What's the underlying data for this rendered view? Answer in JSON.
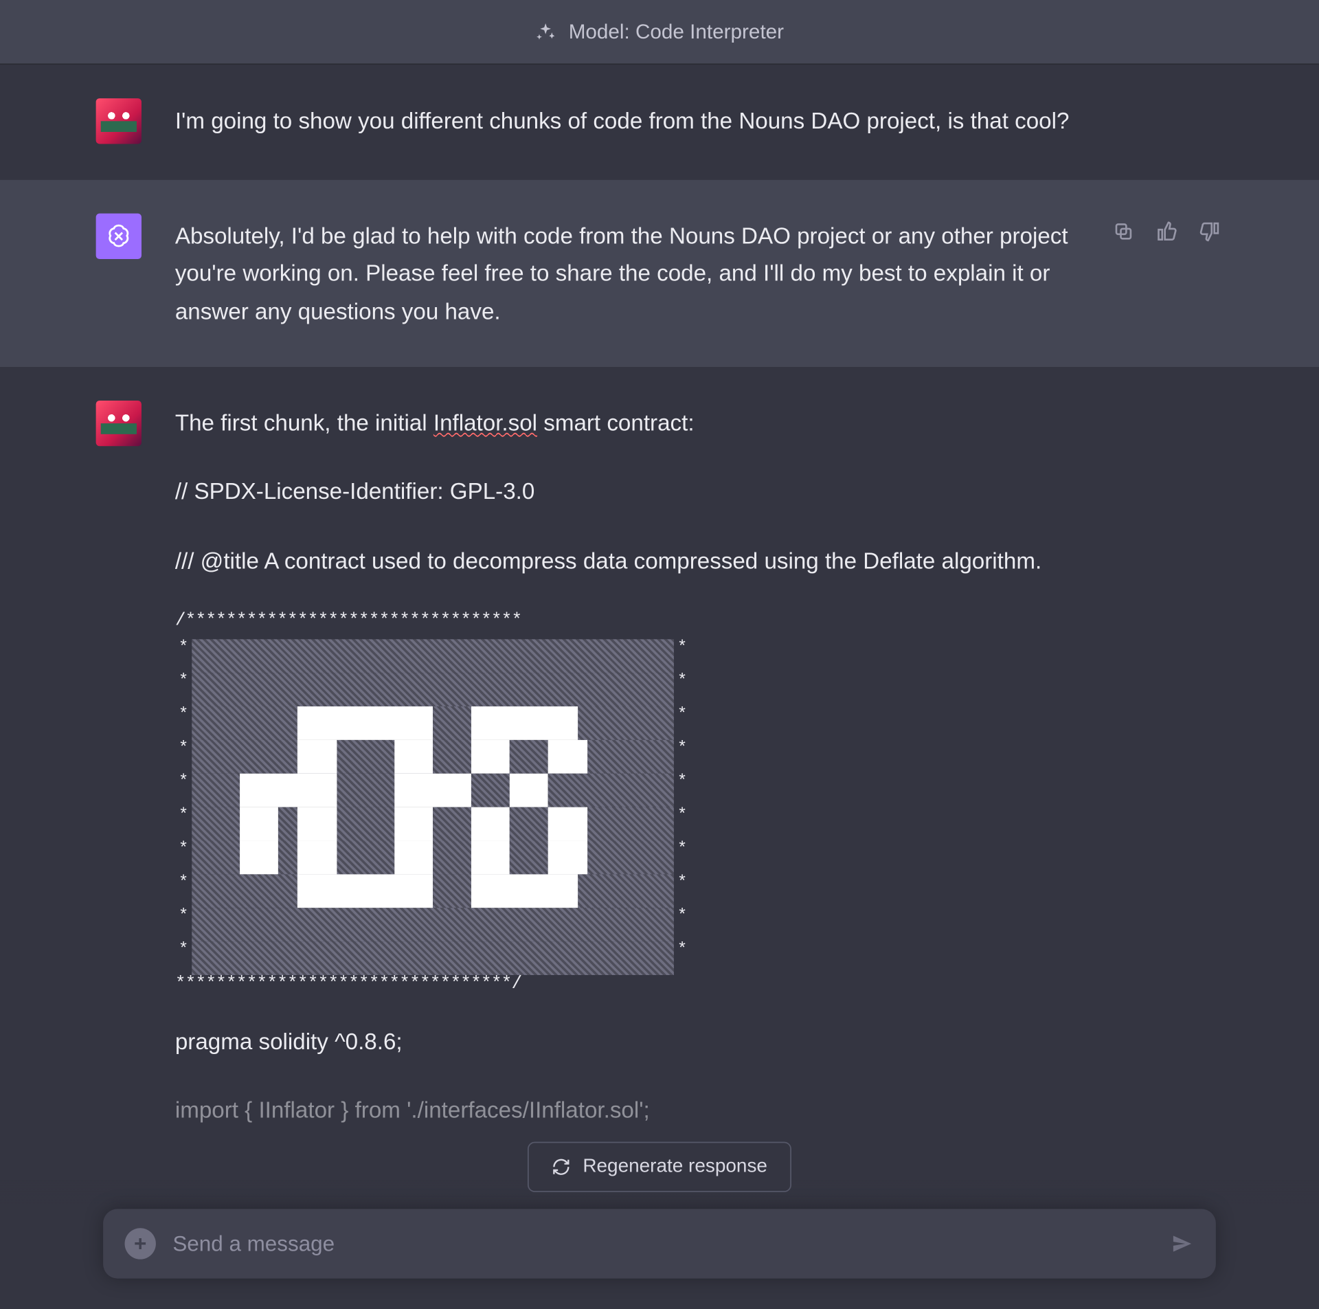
{
  "header": {
    "model_label": "Model: Code Interpreter"
  },
  "messages": {
    "m1": {
      "text": "I'm going to show you different chunks of code from the Nouns DAO project, is that cool?"
    },
    "m2": {
      "text": "Absolutely, I'd be glad to help with code from the Nouns DAO project or any other project you're working on. Please feel free to share the code, and I'll do my best to explain it or answer any questions you have."
    },
    "m3": {
      "intro_pre": "The first chunk, the initial ",
      "intro_underlined": "Inflator.sol",
      "intro_post": " smart contract:",
      "spdx": "// SPDX-License-Identifier: GPL-3.0",
      "title_comment": "/// @title A contract used to decompress data compressed using the Deflate algorithm.",
      "stars_open": "/*********************************",
      "stars_close": "*********************************/",
      "pragma": "pragma solidity ^0.8.6;",
      "import_line": "import { IInflator } from './interfaces/IInflator.sol';"
    }
  },
  "controls": {
    "regenerate": "Regenerate response",
    "input_placeholder": "Send a message"
  },
  "icons": {
    "copy": "copy-icon",
    "thumbs_up": "thumbs-up-icon",
    "thumbs_down": "thumbs-down-icon",
    "plus": "+"
  }
}
